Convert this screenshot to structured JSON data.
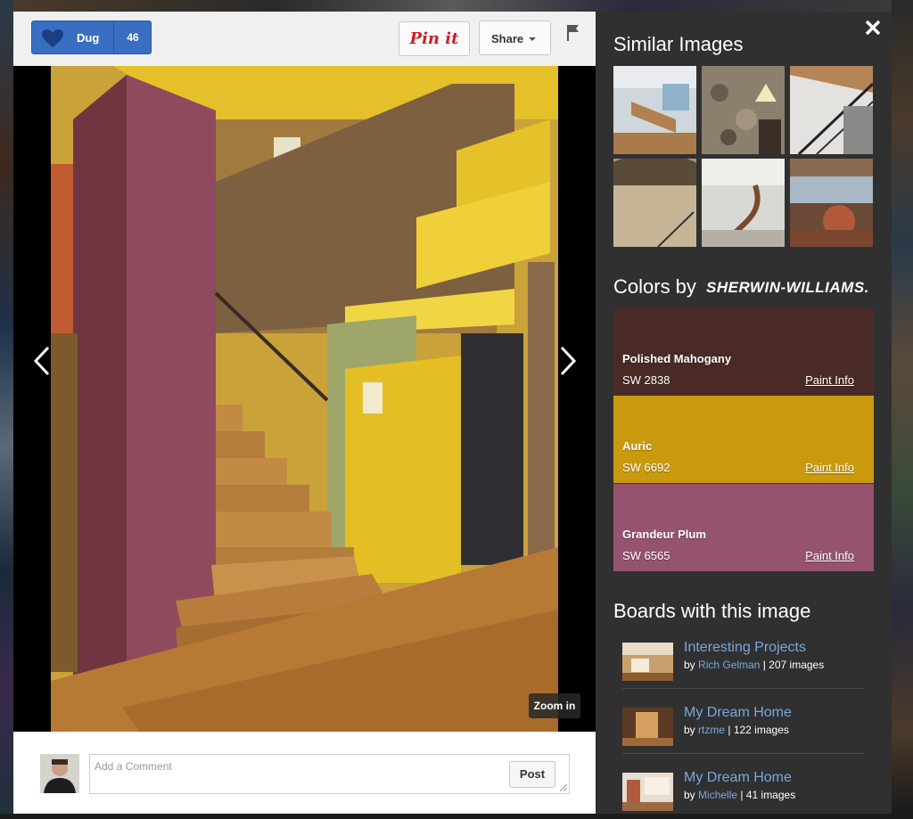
{
  "toolbar": {
    "dug_label": "Dug",
    "dug_count": "46",
    "pin_label": "Pin it",
    "share_label": "Share"
  },
  "viewer": {
    "zoom_label": "Zoom in"
  },
  "comment": {
    "placeholder": "Add a Comment",
    "post_label": "Post"
  },
  "panel": {
    "similar_title": "Similar Images",
    "colors_title": "Colors by",
    "colors_brand": "SHERWIN-WILLIAMS.",
    "swatches": [
      {
        "name": "Polished Mahogany",
        "code": "SW 2838",
        "info": "Paint Info",
        "color": "#4a2a26"
      },
      {
        "name": "Auric",
        "code": "SW 6692",
        "info": "Paint Info",
        "color": "#c99a0e"
      },
      {
        "name": "Grandeur Plum",
        "code": "SW 6565",
        "info": "Paint Info",
        "color": "#95536f"
      }
    ],
    "boards_title": "Boards with this image",
    "boards": [
      {
        "title": "Interesting Projects",
        "by": "by",
        "user": "Rich Gelman",
        "count": "| 207 images"
      },
      {
        "title": "My Dream Home",
        "by": "by",
        "user": "rtzme",
        "count": "| 122 images"
      },
      {
        "title": "My Dream Home",
        "by": "by",
        "user": "Michelle",
        "count": "| 41 images"
      }
    ]
  },
  "colors": {
    "dug_blue": "#3a6ec2",
    "pin_red": "#cb2027",
    "panel_bg": "#303030",
    "link_blue": "#7aa7e0"
  }
}
